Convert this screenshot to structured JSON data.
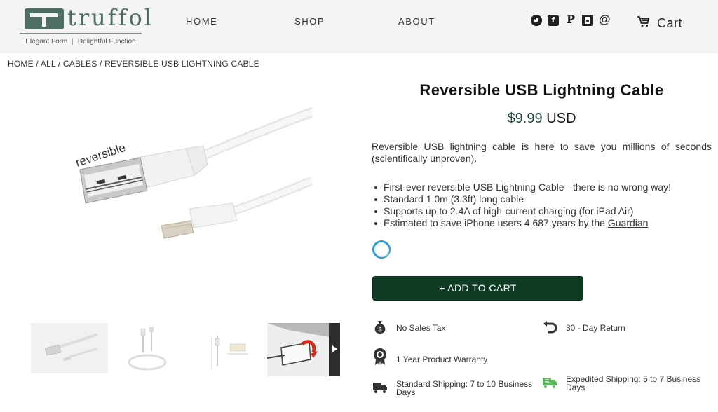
{
  "brand": {
    "name": "truffol",
    "tagline_left": "Elegant Form",
    "tagline_sep": "|",
    "tagline_right": "Delightful Function"
  },
  "nav": {
    "home": "HOME",
    "shop": "SHOP",
    "about": "ABOUT",
    "cart": "Cart"
  },
  "social_icons": [
    "twitter-icon",
    "facebook-icon",
    "pinterest-icon",
    "instagram-icon",
    "email-icon"
  ],
  "breadcrumb": [
    "HOME",
    "ALL",
    "CABLES",
    "REVERSIBLE USB LIGHTNING CABLE"
  ],
  "breadcrumb_sep": " / ",
  "product": {
    "image_label": "reversible",
    "title": "Reversible USB Lightning Cable",
    "price": "$9.99",
    "currency": "USD",
    "description": "Reversible USB lightning cable is here to save you millions of seconds (scientifically unproven).",
    "features": [
      "First-ever reversible USB Lightning Cable - there is no wrong way!",
      "Standard 1.0m (3.3ft) long cable",
      "Supports up to 2.4A of high-current charging (for iPad Air)"
    ],
    "feature_last_prefix": "Estimated to save iPhone users 4,687 years by the ",
    "feature_last_link": "Guardian",
    "add_to_cart": "+ ADD TO CART"
  },
  "perks": {
    "no_tax": "No Sales Tax",
    "return": "30 - Day Return",
    "warranty": "1 Year Product Warranty",
    "standard_shipping": "Standard Shipping: 7 to 10 Business Days",
    "expedited_shipping": "Expedited Shipping: 5 to 7 Business Days"
  },
  "colors": {
    "accent": "#0f3b24",
    "brand": "#4f6e63",
    "price": "#1f4a33",
    "spinner": "#2b9bd3"
  }
}
